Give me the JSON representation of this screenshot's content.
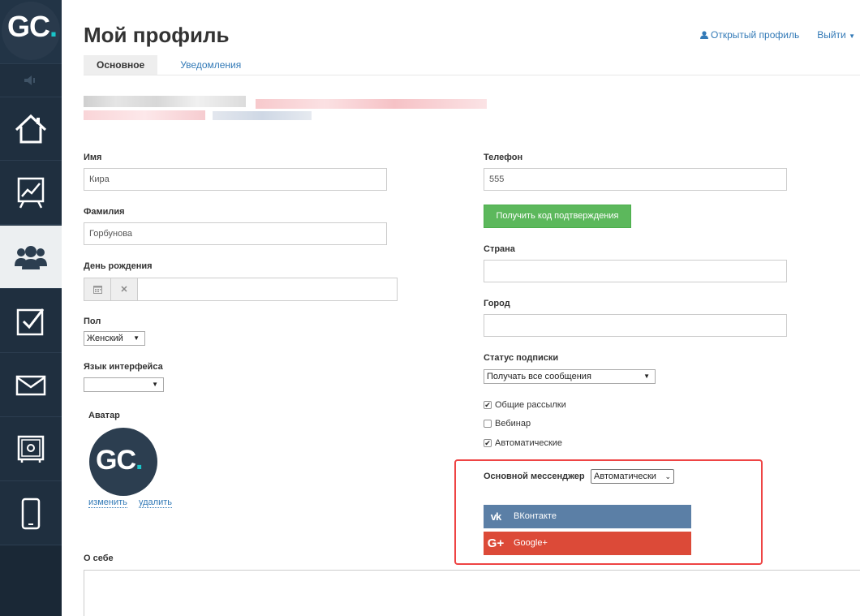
{
  "app": {
    "logo": {
      "main": "GC",
      "dot": "."
    }
  },
  "header": {
    "title": "Мой профиль",
    "public_profile_label": "Открытый профиль",
    "logout_label": "Выйти",
    "tabs": [
      {
        "label": "Основное",
        "active": true
      },
      {
        "label": "Уведомления",
        "active": false
      }
    ]
  },
  "form": {
    "first_name": {
      "label": "Имя",
      "value": "Кира"
    },
    "last_name": {
      "label": "Фамилия",
      "value": "Горбунова"
    },
    "birthday": {
      "label": "День рождения",
      "value": ""
    },
    "gender": {
      "label": "Пол",
      "value": "Женский"
    },
    "language": {
      "label": "Язык интерфейса",
      "value": ""
    },
    "avatar": {
      "label": "Аватар",
      "logo_main": "GC",
      "logo_dot": ".",
      "change_label": "изменить",
      "delete_label": "удалить"
    },
    "about": {
      "label": "О себе",
      "value": ""
    },
    "phone": {
      "label": "Телефон",
      "value": "555"
    },
    "get_code_label": "Получить код подтверждения",
    "country": {
      "label": "Страна",
      "value": ""
    },
    "city": {
      "label": "Город",
      "value": ""
    },
    "subscription": {
      "label": "Статус подписки",
      "value": "Получать все сообщения",
      "options": [
        {
          "label": "Общие рассылки",
          "checked": true
        },
        {
          "label": "Вебинар",
          "checked": false
        },
        {
          "label": "Автоматические",
          "checked": true
        }
      ]
    },
    "messenger": {
      "label": "Основной мессенджер",
      "value": "Автоматически"
    },
    "social": {
      "vk": {
        "icon": "vk-icon",
        "label": "ВКонтакте",
        "glyph": "vk"
      },
      "google": {
        "icon": "google-plus-icon",
        "label": "Google+",
        "glyph": "G+"
      }
    }
  },
  "colors": {
    "sidebar": "#1f2f3f",
    "accent": "#19c5c9",
    "link": "#337ab7",
    "green_button": "#5cb85c",
    "vk": "#5b7fa6",
    "google": "#dc4a38",
    "highlight_box": "#ee4444"
  }
}
